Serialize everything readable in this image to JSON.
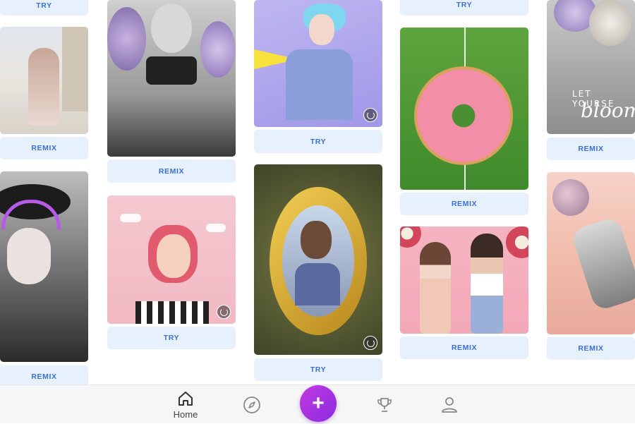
{
  "feed": {
    "col1": {
      "top_button": "TRY",
      "mid_button": "REMIX",
      "bottom_button": "REMIX"
    },
    "col2": {
      "top_button": "REMIX",
      "bottom_button": "TRY"
    },
    "col3": {
      "top_button": "TRY",
      "bottom_button": "TRY"
    },
    "col4": {
      "top_button": "TRY",
      "mid_button": "REMIX",
      "bottom_button": "REMIX"
    },
    "col5": {
      "overlay_line1": "LET YOURSE",
      "overlay_line2": "bloom",
      "top_button": "REMIX",
      "bottom_button": "REMIX"
    }
  },
  "bottom_nav": {
    "home_label": "Home",
    "create_symbol": "+",
    "icons": [
      "home-icon",
      "compass-icon",
      "plus-icon",
      "trophy-icon",
      "profile-icon"
    ],
    "accent_color": "#a032e0"
  }
}
